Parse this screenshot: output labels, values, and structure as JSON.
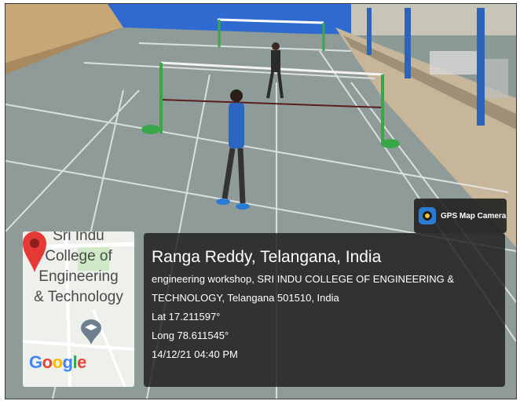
{
  "camera_badge": {
    "label": "GPS Map Camera",
    "icon": "gps-map-camera-icon"
  },
  "location": {
    "place": "Ranga Reddy, Telangana, India",
    "address_line1": "engineering workshop, SRI INDU COLLEGE OF ENGINEERING &",
    "address_line2": "TECHNOLOGY, Telangana 501510, India",
    "lat": "Lat 17.211597°",
    "long": "Long 78.611545°",
    "datetime": "14/12/21 04:40 PM"
  },
  "map": {
    "label_top": "Sri Indu",
    "label_line1": "College of",
    "label_line2": "Engineering",
    "label_line3": "& Technology",
    "brand": "Google",
    "pin_icon": "map-pin-icon",
    "poi_icon": "graduation-cap-icon"
  }
}
